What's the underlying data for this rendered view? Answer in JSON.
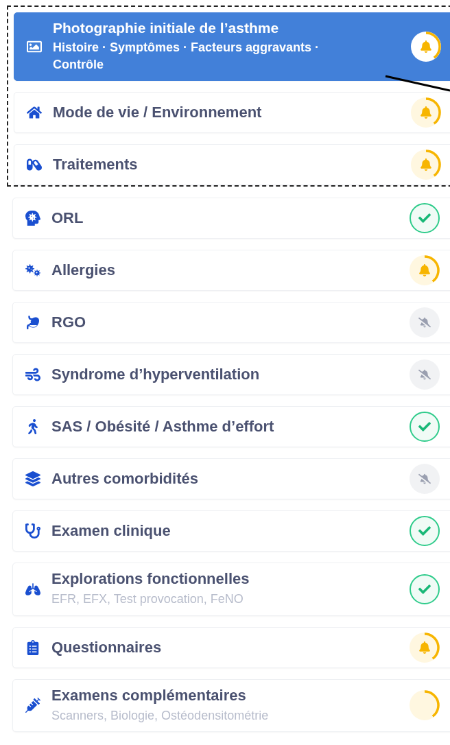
{
  "framed_items": [
    {
      "title": "Photographie initiale de l’asthme",
      "subtitle": "Histoire · Symptômes · Facteurs aggravants · Contrôle",
      "selected": true,
      "kind": "alert"
    },
    {
      "title": "Mode de vie / Environnement",
      "selected": false,
      "kind": "alert"
    },
    {
      "title": "Traitements",
      "selected": false,
      "kind": "alert"
    }
  ],
  "items": [
    {
      "title": "ORL",
      "selected": false,
      "kind": "done"
    },
    {
      "title": "Allergies",
      "selected": false,
      "kind": "alert"
    },
    {
      "title": "RGO",
      "selected": false,
      "kind": "muted"
    },
    {
      "title": "Syndrome d’hyperventilation",
      "selected": false,
      "kind": "muted"
    },
    {
      "title": "SAS / Obésité / Asthme d’effort",
      "selected": false,
      "kind": "done"
    },
    {
      "title": "Autres comorbidités",
      "selected": false,
      "kind": "muted"
    },
    {
      "title": "Examen clinique",
      "selected": false,
      "kind": "done"
    },
    {
      "title": "Explorations fonctionnelles",
      "subtitle": "EFR, EFX, Test provocation, FeNO",
      "selected": false,
      "kind": "done"
    },
    {
      "title": "Questionnaires",
      "selected": false,
      "kind": "alert"
    },
    {
      "title": "Examens complémentaires",
      "subtitle": "Scanners, Biologie, Ostéodensitométrie",
      "selected": false,
      "kind": "pending"
    }
  ]
}
